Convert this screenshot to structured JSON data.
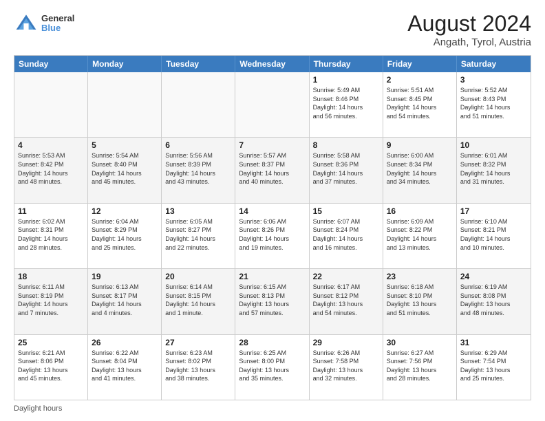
{
  "header": {
    "logo_line1": "General",
    "logo_line2": "Blue",
    "title": "August 2024",
    "subtitle": "Angath, Tyrol, Austria"
  },
  "days_of_week": [
    "Sunday",
    "Monday",
    "Tuesday",
    "Wednesday",
    "Thursday",
    "Friday",
    "Saturday"
  ],
  "footer_label": "Daylight hours",
  "weeks": [
    [
      {
        "day": "",
        "info": ""
      },
      {
        "day": "",
        "info": ""
      },
      {
        "day": "",
        "info": ""
      },
      {
        "day": "",
        "info": ""
      },
      {
        "day": "1",
        "info": "Sunrise: 5:49 AM\nSunset: 8:46 PM\nDaylight: 14 hours\nand 56 minutes."
      },
      {
        "day": "2",
        "info": "Sunrise: 5:51 AM\nSunset: 8:45 PM\nDaylight: 14 hours\nand 54 minutes."
      },
      {
        "day": "3",
        "info": "Sunrise: 5:52 AM\nSunset: 8:43 PM\nDaylight: 14 hours\nand 51 minutes."
      }
    ],
    [
      {
        "day": "4",
        "info": "Sunrise: 5:53 AM\nSunset: 8:42 PM\nDaylight: 14 hours\nand 48 minutes."
      },
      {
        "day": "5",
        "info": "Sunrise: 5:54 AM\nSunset: 8:40 PM\nDaylight: 14 hours\nand 45 minutes."
      },
      {
        "day": "6",
        "info": "Sunrise: 5:56 AM\nSunset: 8:39 PM\nDaylight: 14 hours\nand 43 minutes."
      },
      {
        "day": "7",
        "info": "Sunrise: 5:57 AM\nSunset: 8:37 PM\nDaylight: 14 hours\nand 40 minutes."
      },
      {
        "day": "8",
        "info": "Sunrise: 5:58 AM\nSunset: 8:36 PM\nDaylight: 14 hours\nand 37 minutes."
      },
      {
        "day": "9",
        "info": "Sunrise: 6:00 AM\nSunset: 8:34 PM\nDaylight: 14 hours\nand 34 minutes."
      },
      {
        "day": "10",
        "info": "Sunrise: 6:01 AM\nSunset: 8:32 PM\nDaylight: 14 hours\nand 31 minutes."
      }
    ],
    [
      {
        "day": "11",
        "info": "Sunrise: 6:02 AM\nSunset: 8:31 PM\nDaylight: 14 hours\nand 28 minutes."
      },
      {
        "day": "12",
        "info": "Sunrise: 6:04 AM\nSunset: 8:29 PM\nDaylight: 14 hours\nand 25 minutes."
      },
      {
        "day": "13",
        "info": "Sunrise: 6:05 AM\nSunset: 8:27 PM\nDaylight: 14 hours\nand 22 minutes."
      },
      {
        "day": "14",
        "info": "Sunrise: 6:06 AM\nSunset: 8:26 PM\nDaylight: 14 hours\nand 19 minutes."
      },
      {
        "day": "15",
        "info": "Sunrise: 6:07 AM\nSunset: 8:24 PM\nDaylight: 14 hours\nand 16 minutes."
      },
      {
        "day": "16",
        "info": "Sunrise: 6:09 AM\nSunset: 8:22 PM\nDaylight: 14 hours\nand 13 minutes."
      },
      {
        "day": "17",
        "info": "Sunrise: 6:10 AM\nSunset: 8:21 PM\nDaylight: 14 hours\nand 10 minutes."
      }
    ],
    [
      {
        "day": "18",
        "info": "Sunrise: 6:11 AM\nSunset: 8:19 PM\nDaylight: 14 hours\nand 7 minutes."
      },
      {
        "day": "19",
        "info": "Sunrise: 6:13 AM\nSunset: 8:17 PM\nDaylight: 14 hours\nand 4 minutes."
      },
      {
        "day": "20",
        "info": "Sunrise: 6:14 AM\nSunset: 8:15 PM\nDaylight: 14 hours\nand 1 minute."
      },
      {
        "day": "21",
        "info": "Sunrise: 6:15 AM\nSunset: 8:13 PM\nDaylight: 13 hours\nand 57 minutes."
      },
      {
        "day": "22",
        "info": "Sunrise: 6:17 AM\nSunset: 8:12 PM\nDaylight: 13 hours\nand 54 minutes."
      },
      {
        "day": "23",
        "info": "Sunrise: 6:18 AM\nSunset: 8:10 PM\nDaylight: 13 hours\nand 51 minutes."
      },
      {
        "day": "24",
        "info": "Sunrise: 6:19 AM\nSunset: 8:08 PM\nDaylight: 13 hours\nand 48 minutes."
      }
    ],
    [
      {
        "day": "25",
        "info": "Sunrise: 6:21 AM\nSunset: 8:06 PM\nDaylight: 13 hours\nand 45 minutes."
      },
      {
        "day": "26",
        "info": "Sunrise: 6:22 AM\nSunset: 8:04 PM\nDaylight: 13 hours\nand 41 minutes."
      },
      {
        "day": "27",
        "info": "Sunrise: 6:23 AM\nSunset: 8:02 PM\nDaylight: 13 hours\nand 38 minutes."
      },
      {
        "day": "28",
        "info": "Sunrise: 6:25 AM\nSunset: 8:00 PM\nDaylight: 13 hours\nand 35 minutes."
      },
      {
        "day": "29",
        "info": "Sunrise: 6:26 AM\nSunset: 7:58 PM\nDaylight: 13 hours\nand 32 minutes."
      },
      {
        "day": "30",
        "info": "Sunrise: 6:27 AM\nSunset: 7:56 PM\nDaylight: 13 hours\nand 28 minutes."
      },
      {
        "day": "31",
        "info": "Sunrise: 6:29 AM\nSunset: 7:54 PM\nDaylight: 13 hours\nand 25 minutes."
      }
    ]
  ]
}
